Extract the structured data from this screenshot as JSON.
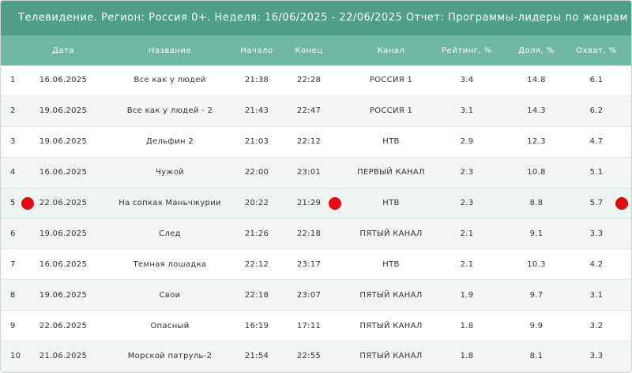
{
  "report": {
    "title": "Телевидение. Регион: Россия 0+. Неделя: 16/06/2025 - 22/06/2025 Отчет: Программы-лидеры по жанрам Жанр: Телесериалы"
  },
  "table": {
    "headers": {
      "num": "",
      "date": "Дата",
      "name": "Название",
      "start": "Начало",
      "end": "Конец",
      "channel": "Канал",
      "rating": "Рейтинг, %",
      "share": "Доля, %",
      "reach": "Охват, %"
    },
    "rows": [
      {
        "num": "1",
        "date": "16.06.2025",
        "name": "Все как у людей",
        "start": "21:38",
        "end": "22:28",
        "channel": "РОССИЯ 1",
        "rating": "3.4",
        "share": "14.8",
        "reach": "6.1"
      },
      {
        "num": "2",
        "date": "19.06.2025",
        "name": "Все как у людей - 2",
        "start": "21:43",
        "end": "22:47",
        "channel": "РОССИЯ 1",
        "rating": "3.1",
        "share": "14.3",
        "reach": "6.2"
      },
      {
        "num": "3",
        "date": "19.06.2025",
        "name": "Дельфин 2",
        "start": "21:03",
        "end": "22:12",
        "channel": "НТВ",
        "rating": "2.9",
        "share": "12.3",
        "reach": "4.7"
      },
      {
        "num": "4",
        "date": "16.06.2025",
        "name": "Чужой",
        "start": "22:00",
        "end": "23:01",
        "channel": "ПЕРВЫЙ КАНАЛ",
        "rating": "2.3",
        "share": "10.8",
        "reach": "5.1"
      },
      {
        "num": "5",
        "date": "22.06.2025",
        "name": "На сопках Маньчжурии",
        "start": "20:22",
        "end": "21:29",
        "channel": "НТВ",
        "rating": "2.3",
        "share": "8.8",
        "reach": "5.7"
      },
      {
        "num": "6",
        "date": "19.06.2025",
        "name": "След",
        "start": "21:26",
        "end": "22:18",
        "channel": "ПЯТЫЙ КАНАЛ",
        "rating": "2.1",
        "share": "9.1",
        "reach": "3.3"
      },
      {
        "num": "7",
        "date": "16.06.2025",
        "name": "Темная лошадка",
        "start": "22:12",
        "end": "23:17",
        "channel": "НТВ",
        "rating": "2.1",
        "share": "10.3",
        "reach": "4.2"
      },
      {
        "num": "8",
        "date": "19.06.2025",
        "name": "Свои",
        "start": "22:18",
        "end": "23:07",
        "channel": "ПЯТЫЙ КАНАЛ",
        "rating": "1.9",
        "share": "9.7",
        "reach": "3.1"
      },
      {
        "num": "9",
        "date": "22.06.2025",
        "name": "Опасный",
        "start": "16:19",
        "end": "17:11",
        "channel": "ПЯТЫЙ КАНАЛ",
        "rating": "1.8",
        "share": "9.9",
        "reach": "3.2"
      },
      {
        "num": "10",
        "date": "21.06.2025",
        "name": "Морской патруль-2",
        "start": "21:54",
        "end": "22:55",
        "channel": "ПЯТЫЙ КАНАЛ",
        "rating": "1.8",
        "share": "8.1",
        "reach": "3.3"
      }
    ]
  },
  "highlight": {
    "row_index": 4,
    "marker_color": "#e50914"
  },
  "colors": {
    "title_bar": "#4f9e8a",
    "header_row": "#6fb7a4"
  }
}
